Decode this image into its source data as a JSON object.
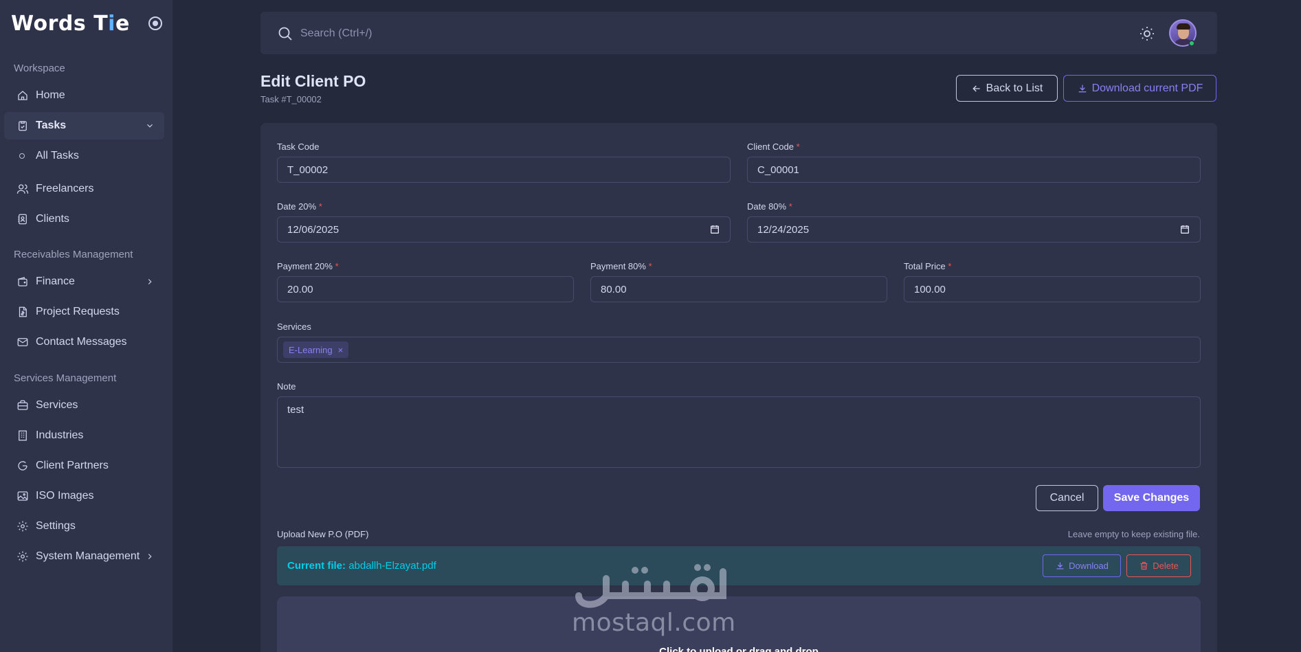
{
  "app": {
    "logo_main": "Words T",
    "logo_accent": "i",
    "logo_end": "e"
  },
  "sidebar": {
    "sections": [
      "Workspace",
      "Receivables Management",
      "Services Management"
    ],
    "items": [
      {
        "label": "Home"
      },
      {
        "label": "Tasks"
      },
      {
        "label": "All Tasks"
      },
      {
        "label": "Freelancers"
      },
      {
        "label": "Clients"
      },
      {
        "label": "Finance"
      },
      {
        "label": "Project Requests"
      },
      {
        "label": "Contact Messages"
      },
      {
        "label": "Services"
      },
      {
        "label": "Industries"
      },
      {
        "label": "Client Partners"
      },
      {
        "label": "ISO Images"
      },
      {
        "label": "Settings"
      },
      {
        "label": "System Management"
      }
    ]
  },
  "topbar": {
    "search_placeholder": "Search (Ctrl+/)"
  },
  "header": {
    "title": "Edit Client PO",
    "subtitle": "Task #T_00002",
    "back_label": "Back to List",
    "pdf_label": "Download current PDF"
  },
  "form": {
    "task_code": {
      "label": "Task Code",
      "value": "T_00002"
    },
    "client_code": {
      "label": "Client Code",
      "required": "*",
      "value": "C_00001"
    },
    "date20": {
      "label": "Date 20%",
      "required": "*",
      "value": "12/06/2025"
    },
    "date80": {
      "label": "Date 80%",
      "required": "*",
      "value": "12/24/2025"
    },
    "payment20": {
      "label": "Payment 20%",
      "required": "*",
      "value": "20.00"
    },
    "payment80": {
      "label": "Payment 80%",
      "required": "*",
      "value": "80.00"
    },
    "total": {
      "label": "Total Price",
      "required": "*",
      "value": "100.00"
    },
    "services": {
      "label": "Services",
      "chip": "E-Learning",
      "chip_remove": "×"
    },
    "note": {
      "label": "Note",
      "value": "test"
    },
    "cancel_label": "Cancel",
    "save_label": "Save Changes"
  },
  "upload": {
    "label": "Upload New P.O (PDF)",
    "hint": "Leave empty to keep existing file.",
    "current_prefix": "Current file:",
    "current_file": "abdallh-Elzayat.pdf",
    "download_label": "Download",
    "delete_label": "Delete",
    "drop_text": "Click to upload or drag and drop"
  },
  "watermark": {
    "arabic": "مستقل",
    "latin": "mostaql.com"
  },
  "colors": {
    "primary": "#7367f0",
    "danger": "#ea5455",
    "info": "#00cfe8",
    "success": "#28c76f"
  }
}
